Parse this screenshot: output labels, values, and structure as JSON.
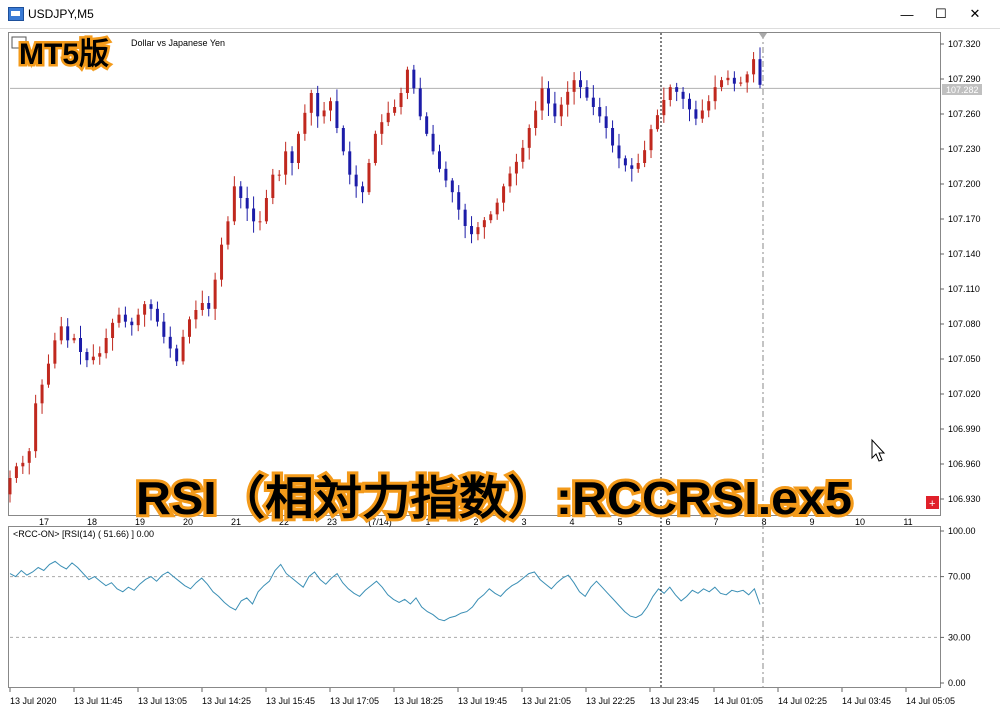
{
  "window": {
    "title": "USDJPY,M5",
    "minimize_glyph": "—",
    "maximize_glyph": "☐",
    "close_glyph": "✕"
  },
  "overlay": {
    "badge": "MT5版",
    "headline": "RSI（相対力指数）:RCCRSI.ex5"
  },
  "colors": {
    "bull": "#c0281e",
    "bear": "#1c1ca8",
    "rsi_line": "#3b8fb5",
    "overlay_text": "#000000",
    "overlay_outline": "#f39a1a",
    "price_tag_bg": "#c0c0c0"
  },
  "chart_data": [
    {
      "type": "candlestick",
      "title": "Dollar vs Japanese Yen",
      "symbol": "USDJPY",
      "timeframe": "M5",
      "current_price_label": "107.282",
      "ylim": [
        106.93,
        107.33
      ],
      "y_ticks": [
        "107.320",
        "107.290",
        "107.260",
        "107.230",
        "107.200",
        "107.170",
        "107.140",
        "107.110",
        "107.080",
        "107.050",
        "107.020",
        "106.990",
        "106.960",
        "106.930"
      ],
      "day_scale": [
        "17",
        "18",
        "19",
        "20",
        "21",
        "22",
        "23",
        "(7/14)",
        "1",
        "2",
        "3",
        "4",
        "5",
        "6",
        "7",
        "8",
        "9",
        "10",
        "11"
      ],
      "period_separator_label": "(7/14)",
      "trade_level_marker": "+",
      "close_prices": [
        106.948,
        106.958,
        106.961,
        106.971,
        107.012,
        107.028,
        107.046,
        107.066,
        107.078,
        107.066,
        107.068,
        107.056,
        107.049,
        107.052,
        107.055,
        107.068,
        107.081,
        107.088,
        107.082,
        107.079,
        107.088,
        107.097,
        107.093,
        107.082,
        107.069,
        107.059,
        107.048,
        107.069,
        107.084,
        107.092,
        107.098,
        107.093,
        107.118,
        107.148,
        107.168,
        107.198,
        107.188,
        107.179,
        107.168,
        107.168,
        107.188,
        107.208,
        107.208,
        107.228,
        107.218,
        107.243,
        107.261,
        107.278,
        107.258,
        107.263,
        107.271,
        107.248,
        107.228,
        107.208,
        107.198,
        107.193,
        107.218,
        107.243,
        107.253,
        107.261,
        107.266,
        107.278,
        107.298,
        107.282,
        107.258,
        107.243,
        107.228,
        107.213,
        107.203,
        107.193,
        107.178,
        107.164,
        107.157,
        107.163,
        107.169,
        107.174,
        107.184,
        107.198,
        107.209,
        107.219,
        107.231,
        107.248,
        107.263,
        107.282,
        107.269,
        107.258,
        107.268,
        107.279,
        107.289,
        107.283,
        107.274,
        107.266,
        107.258,
        107.248,
        107.233,
        107.222,
        107.216,
        107.213,
        107.218,
        107.229,
        107.247,
        107.259,
        107.272,
        107.283,
        107.279,
        107.273,
        107.264,
        107.256,
        107.263,
        107.271,
        107.283,
        107.289,
        107.291,
        107.286,
        107.287,
        107.294,
        107.307,
        107.285
      ],
      "open_first": 106.934,
      "high_max": 107.314,
      "low_min": 106.928
    },
    {
      "type": "line",
      "title": "<RCC-ON> [RSI(14) ( 51.66) ]  0.00",
      "indicator": "RSI(14)",
      "last_value": 51.66,
      "ylim": [
        0,
        100
      ],
      "levels": [
        70,
        30
      ],
      "y_ticks": [
        "100.00",
        "70.00",
        "30.00",
        "0.00"
      ],
      "values": [
        72,
        70,
        74,
        71,
        73,
        76,
        74,
        78,
        80,
        77,
        75,
        79,
        76,
        72,
        68,
        70,
        67,
        64,
        66,
        62,
        60,
        63,
        61,
        65,
        68,
        70,
        67,
        71,
        73,
        70,
        67,
        64,
        62,
        66,
        69,
        65,
        60,
        57,
        53,
        50,
        48,
        54,
        56,
        52,
        60,
        64,
        67,
        74,
        78,
        72,
        69,
        66,
        63,
        70,
        73,
        68,
        65,
        69,
        72,
        66,
        62,
        59,
        57,
        61,
        64,
        67,
        63,
        58,
        55,
        53,
        55,
        52,
        56,
        50,
        47,
        45,
        42,
        41,
        43,
        44,
        46,
        47,
        50,
        55,
        58,
        62,
        59,
        57,
        61,
        64,
        66,
        69,
        72,
        73,
        68,
        65,
        62,
        66,
        69,
        71,
        66,
        60,
        57,
        63,
        67,
        63,
        59,
        55,
        51,
        47,
        44,
        43,
        45,
        50,
        57,
        62,
        59,
        63,
        58,
        54,
        57,
        61,
        59,
        62,
        60,
        63,
        59,
        58,
        61,
        60,
        61,
        58,
        62,
        51.66
      ],
      "time_labels": [
        "13 Jul 2020",
        "13 Jul 11:45",
        "13 Jul 13:05",
        "13 Jul 14:25",
        "13 Jul 15:45",
        "13 Jul 17:05",
        "13 Jul 18:25",
        "13 Jul 19:45",
        "13 Jul 21:05",
        "13 Jul 22:25",
        "13 Jul 23:45",
        "14 Jul 01:05",
        "14 Jul 02:25",
        "14 Jul 03:45",
        "14 Jul 05:05"
      ]
    }
  ]
}
